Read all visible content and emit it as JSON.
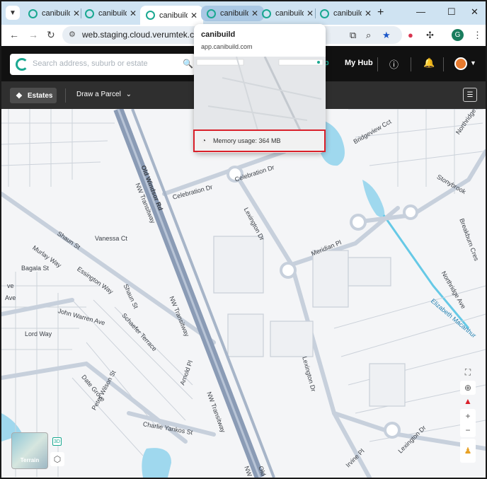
{
  "browser": {
    "tabs": [
      {
        "label": "canibuild"
      },
      {
        "label": "canibuild"
      },
      {
        "label": "canibuild"
      },
      {
        "label": "canibuild"
      },
      {
        "label": "canibuild"
      },
      {
        "label": "canibuild"
      }
    ],
    "url": "web.staging.cloud.verumtek.com.au",
    "profile_initial": "G"
  },
  "hover_card": {
    "title": "canibuild",
    "url": "app.canibuild.com",
    "memory": "Memory usage: 364 MB"
  },
  "app": {
    "search_placeholder": "Search address, suburb or estate",
    "partial_text": "p",
    "my_hub": "My Hub",
    "estates": "Estates",
    "draw_parcel": "Draw a Parcel",
    "terrain": "Terrain",
    "view_3d": "3D"
  },
  "map_labels": [
    "Old Windsor Rd",
    "Celebration Dr",
    "Celebration Dr",
    "NW Transitway",
    "Lexington Dr",
    "Shaun St",
    "Vanessa Ct",
    "Murlay Way",
    "Bagala St",
    "Essington Way",
    "Shaun St",
    "Meridian Pl",
    "John Warren Ave",
    "Schaefer Terrace",
    "NW Transitway",
    "Lord Way",
    "Lexington Dr",
    "Date Grove",
    "Peter Wilson St",
    "Arnold Pl",
    "NW Transitway",
    "Charlie Yankos St",
    "Lexington Dr",
    "Irvine Pl",
    "Old",
    "Bridgeview Cct",
    "Northridge Ave",
    "Stonybrook",
    "Breakburn Cres",
    "Northridge Ave",
    "Elizabeth Macarthur",
    "ve",
    "Ave",
    "NW"
  ],
  "colors": {
    "tab_strip": "#cfe3f2",
    "brand": "#1aa891",
    "highlight": "#d9202a",
    "water": "#9fd8ee",
    "motorway": "#8a9bb5"
  }
}
